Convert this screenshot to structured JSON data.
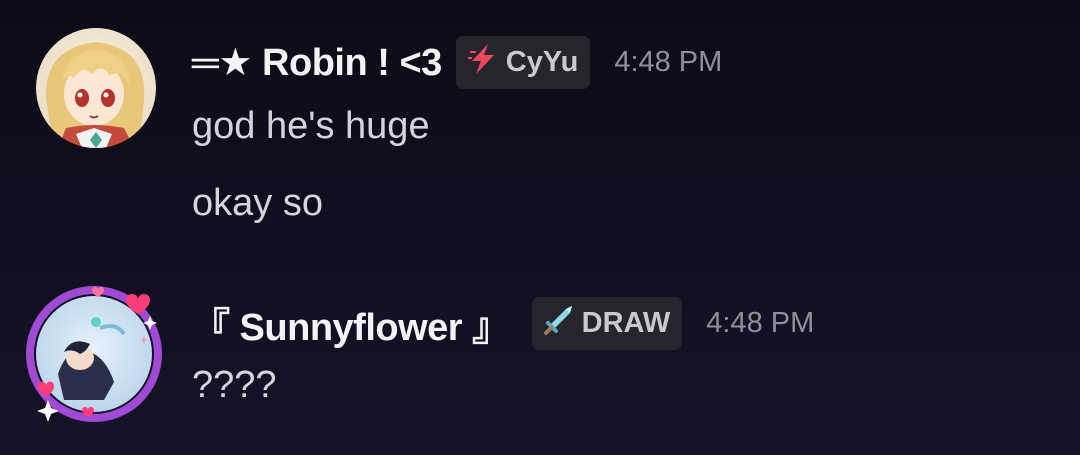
{
  "messages": [
    {
      "author": {
        "name": "═★ Robin ! <3",
        "avatar_icon": "anime-girl-avatar",
        "tag": {
          "icon": "lightning-bolt-icon",
          "label": "CyYu"
        }
      },
      "timestamp": "4:48 PM",
      "lines": [
        "god he's huge",
        "okay so"
      ]
    },
    {
      "author": {
        "name": "『 Sunnyflower 』",
        "avatar_icon": "anime-boy-avatar-with-hearts-frame",
        "tag": {
          "icon": "sword-icon",
          "label": "DRAW"
        }
      },
      "timestamp": "4:48 PM",
      "lines": [
        "????"
      ]
    }
  ],
  "colors": {
    "background": "#0d0b17",
    "username": "#f2f3f5",
    "message_text": "#d4d5dc",
    "timestamp": "#8f909a",
    "tag_background": "#26252e",
    "lightning": "#f0475a",
    "sword": "#8fd8e6"
  }
}
